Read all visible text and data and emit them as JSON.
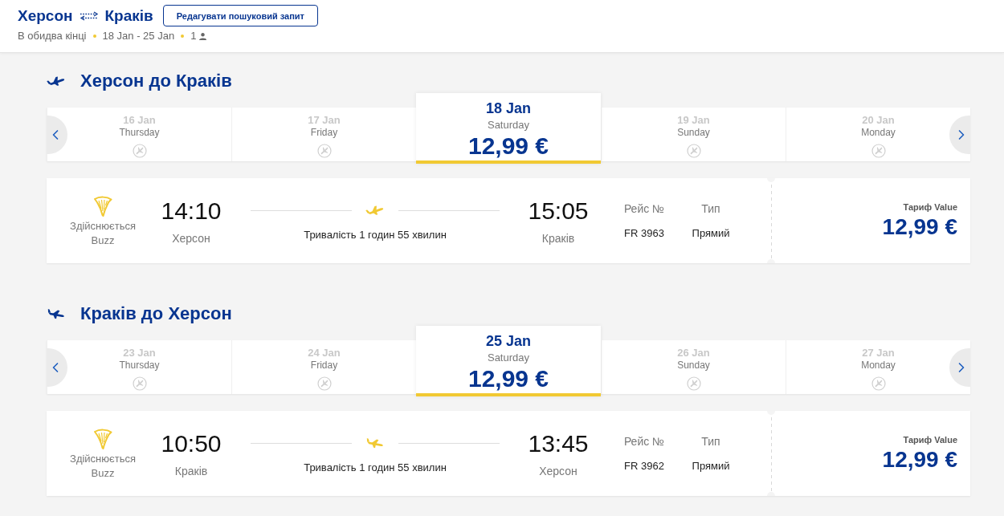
{
  "header": {
    "origin": "Херсон",
    "destination": "Краків",
    "edit_button": "Редагувати пошуковий запит",
    "trip_type": "В обидва кінці",
    "dates": "18 Jan - 25 Jan",
    "passengers": "1"
  },
  "legs": [
    {
      "kind": "outbound",
      "title": "Херсон до Краків",
      "days": [
        {
          "date": "16 Jan",
          "weekday": "Thursday",
          "selected": false,
          "available": false
        },
        {
          "date": "17 Jan",
          "weekday": "Friday",
          "selected": false,
          "available": false
        },
        {
          "date": "18 Jan",
          "weekday": "Saturday",
          "selected": true,
          "available": true,
          "price": "12,99 €"
        },
        {
          "date": "19 Jan",
          "weekday": "Sunday",
          "selected": false,
          "available": false
        },
        {
          "date": "20 Jan",
          "weekday": "Monday",
          "selected": false,
          "available": false
        }
      ],
      "flight": {
        "operator_label": "Здійснюється",
        "operator": "Buzz",
        "depart_time": "14:10",
        "depart_city": "Херсон",
        "duration": "Тривалість 1 годин 55 хвилин",
        "arrive_time": "15:05",
        "arrive_city": "Краків",
        "flight_no_label": "Рейс №",
        "flight_no": "FR 3963",
        "type_label": "Тип",
        "type": "Прямий",
        "fare_label": "Тариф Value",
        "fare_price": "12,99 €"
      }
    },
    {
      "kind": "return",
      "title": "Краків до Херсон",
      "days": [
        {
          "date": "23 Jan",
          "weekday": "Thursday",
          "selected": false,
          "available": false
        },
        {
          "date": "24 Jan",
          "weekday": "Friday",
          "selected": false,
          "available": false
        },
        {
          "date": "25 Jan",
          "weekday": "Saturday",
          "selected": true,
          "available": true,
          "price": "12,99 €"
        },
        {
          "date": "26 Jan",
          "weekday": "Sunday",
          "selected": false,
          "available": false
        },
        {
          "date": "27 Jan",
          "weekday": "Monday",
          "selected": false,
          "available": false
        }
      ],
      "flight": {
        "operator_label": "Здійснюється",
        "operator": "Buzz",
        "depart_time": "10:50",
        "depart_city": "Краків",
        "duration": "Тривалість 1 годин 55 хвилин",
        "arrive_time": "13:45",
        "arrive_city": "Херсон",
        "flight_no_label": "Рейс №",
        "flight_no": "FR 3962",
        "type_label": "Тип",
        "type": "Прямий",
        "fare_label": "Тариф Value",
        "fare_price": "12,99 €"
      }
    }
  ]
}
